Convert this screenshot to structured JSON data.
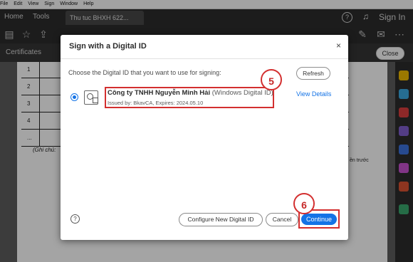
{
  "menu": [
    "File",
    "Edit",
    "View",
    "Sign",
    "Window",
    "Help"
  ],
  "tabs": {
    "home": "Home",
    "tools": "Tools",
    "document": "Thu tuc BHXH 622..."
  },
  "header": {
    "help": "?",
    "sign_in": "Sign In"
  },
  "certificates": {
    "title": "Certificates",
    "close": "Close"
  },
  "doc": {
    "row_numbers": [
      "1",
      "2",
      "3",
      "4",
      "..."
    ],
    "note": "(Ghi chú:",
    "trailing": "ền trước"
  },
  "dialog": {
    "title": "Sign with a Digital ID",
    "close": "×",
    "prompt": "Choose the Digital ID that you want to use for signing:",
    "refresh": "Refresh",
    "id_name": "Công ty TNHH Nguyễn Minh Hải",
    "id_type": "(Windows Digital ID)",
    "id_issued": "Issued by: BkavCA, Expires: 2024.05.10",
    "view_details": "View Details",
    "help": "?",
    "configure": "Configure New Digital ID",
    "cancel": "Cancel",
    "continue": "Continue"
  },
  "annotations": {
    "step5": "5",
    "step6": "6"
  },
  "colors": {
    "accent": "#1473e6",
    "annotation": "#d32f2f"
  }
}
